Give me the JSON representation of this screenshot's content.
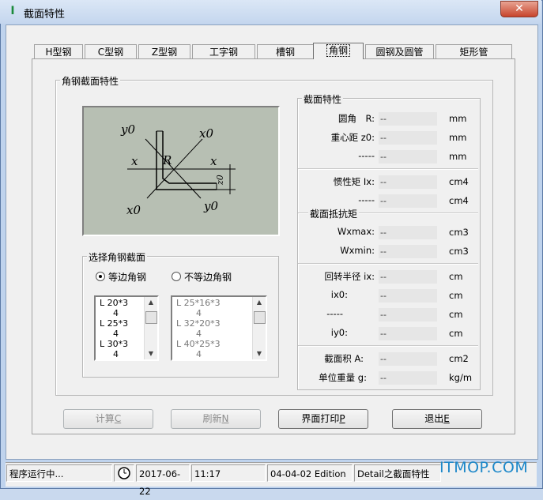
{
  "window": {
    "title": "截面特性",
    "app_icon": "I-beam-icon",
    "close_label": "✕"
  },
  "tabs": [
    {
      "label": "H型钢",
      "active": false
    },
    {
      "label": "C型钢",
      "active": false
    },
    {
      "label": "Z型钢",
      "active": false
    },
    {
      "label": "工字钢",
      "active": false
    },
    {
      "label": "槽钢",
      "active": false
    },
    {
      "label": "角钢",
      "active": true
    },
    {
      "label": "圆钢及圆管",
      "active": false
    },
    {
      "label": "矩形管",
      "active": false
    }
  ],
  "section_group": {
    "title": "角钢截面特性"
  },
  "diagram": {
    "labels": {
      "y0_top": "y0",
      "x0_top": "x0",
      "x_left": "x",
      "x_right": "x",
      "R": "R",
      "z0": "z0",
      "x0_bottom": "x0",
      "y0_bottom": "y0"
    }
  },
  "select_group": {
    "title": "选择角钢截面",
    "radio_equal": "等边角钢",
    "radio_unequal": "不等边角钢",
    "selected": "equal",
    "equal_list": [
      "L 20*3",
      "4",
      "L 25*3",
      "4",
      "L 30*3",
      "4"
    ],
    "unequal_list": [
      "L 25*16*3",
      "4",
      "L 32*20*3",
      "4",
      "L 40*25*3",
      "4"
    ]
  },
  "properties": {
    "title": "截面特性",
    "rows": [
      {
        "label": "圆角　R:",
        "value": "--",
        "unit": "mm"
      },
      {
        "label": "重心距 z0:",
        "value": "--",
        "unit": "mm"
      },
      {
        "label": "-----",
        "value": "--",
        "unit": "mm"
      },
      {
        "label": "惯性矩 Ix:",
        "value": "--",
        "unit": "cm4"
      },
      {
        "label": "-----",
        "value": "--",
        "unit": "cm4"
      },
      {
        "label": "Wxmax:",
        "value": "--",
        "unit": "cm3"
      },
      {
        "label": "Wxmin:",
        "value": "--",
        "unit": "cm3"
      },
      {
        "label": "回转半径 ix:",
        "value": "--",
        "unit": "cm"
      },
      {
        "label": "ix0:",
        "value": "--",
        "unit": "cm"
      },
      {
        "label": "-----",
        "value": "--",
        "unit": "cm"
      },
      {
        "label": "iy0:",
        "value": "--",
        "unit": "cm"
      },
      {
        "label": "截面积 A:",
        "value": "--",
        "unit": "cm2"
      },
      {
        "label": "单位重量 g:",
        "value": "--",
        "unit": "kg/m"
      }
    ],
    "resist_label": "截面抵抗矩"
  },
  "buttons": {
    "calc": {
      "label": "计算",
      "key": "C"
    },
    "refresh": {
      "label": "刷新",
      "key": "N"
    },
    "print": {
      "label": "界面打印",
      "key": "P"
    },
    "exit": {
      "label": "退出",
      "key": "E"
    }
  },
  "statusbar": {
    "status": "程序运行中...",
    "clock_icon": "clock-icon",
    "date": "2017-06-22",
    "time": "11:17",
    "edition": "04-04-02 Edition",
    "module": "Detail之截面特性"
  },
  "watermark": "ITMOP.COM"
}
